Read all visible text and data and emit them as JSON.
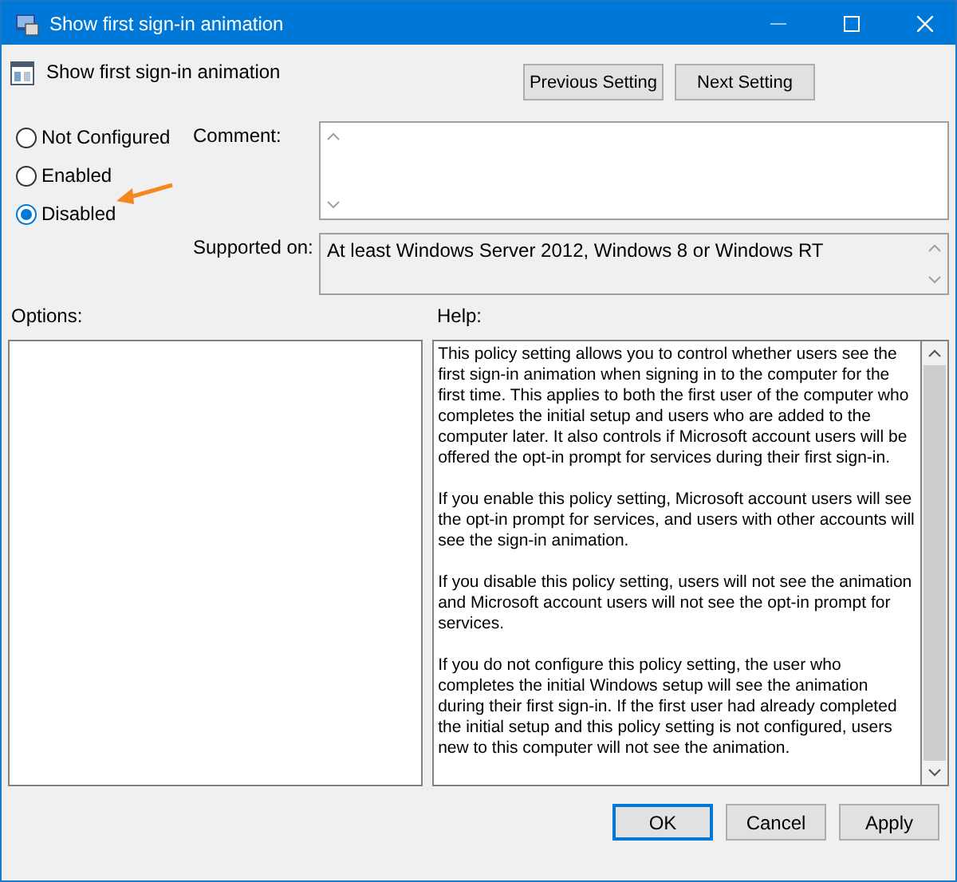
{
  "window": {
    "title": "Show first sign-in animation"
  },
  "header": {
    "title": "Show first sign-in animation"
  },
  "nav_buttons": [
    "Previous Setting",
    "Next Setting"
  ],
  "options": [
    {
      "label": "Not Configured",
      "selected": false
    },
    {
      "label": "Enabled",
      "selected": false
    },
    {
      "label": "Disabled",
      "selected": true
    }
  ],
  "comment": {
    "label": "Comment:"
  },
  "supported_on": {
    "label": "Supported on:",
    "value": "At least Windows Server 2012, Windows 8 or Windows RT"
  },
  "options_panel": {
    "label": "Options:"
  },
  "help": {
    "label": "Help:",
    "paragraphs": [
      "This policy setting allows you to control whether users see the first sign-in animation when signing in to the computer for the first time.  This applies to both the first user of the computer who completes the initial setup and users who are added to the computer later.  It also controls if Microsoft account users will be offered the opt-in prompt for services during their first sign-in.",
      "If you enable this policy setting, Microsoft account users will see the opt-in prompt for services, and users with other accounts will see the sign-in animation.",
      "If you disable this policy setting, users will not see the animation and Microsoft account users will not see the opt-in prompt for services.",
      "If you do not configure this policy setting, the user who completes the initial Windows setup will see the animation during their first sign-in. If the first user had already completed the initial setup and this policy setting is not configured, users new to this computer will not see the animation."
    ]
  },
  "buttons": [
    {
      "label": "OK",
      "default": true
    },
    {
      "label": "Cancel",
      "default": false
    },
    {
      "label": "Apply",
      "default": false
    }
  ]
}
